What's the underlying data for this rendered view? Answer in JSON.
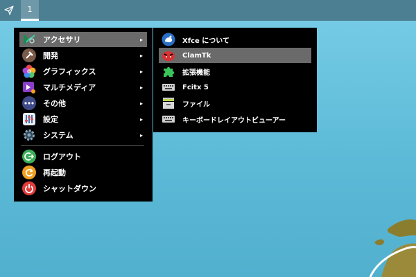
{
  "panel": {
    "workspace_label": "1"
  },
  "menu": {
    "items": [
      {
        "label": "アクセサリ",
        "icon": "accessories-icon",
        "has_submenu": true
      },
      {
        "label": "開発",
        "icon": "development-icon",
        "has_submenu": true
      },
      {
        "label": "グラフィックス",
        "icon": "graphics-icon",
        "has_submenu": true
      },
      {
        "label": "マルチメディア",
        "icon": "multimedia-icon",
        "has_submenu": true
      },
      {
        "label": "その他",
        "icon": "other-icon",
        "has_submenu": true
      },
      {
        "label": "設定",
        "icon": "settings-icon",
        "has_submenu": true
      },
      {
        "label": "システム",
        "icon": "system-icon",
        "has_submenu": true
      }
    ],
    "actions": [
      {
        "label": "ログアウト",
        "icon": "logout-icon"
      },
      {
        "label": "再起動",
        "icon": "restart-icon"
      },
      {
        "label": "シャットダウン",
        "icon": "shutdown-icon"
      }
    ],
    "submenu_arrow": "▸"
  },
  "submenu": {
    "items": [
      {
        "label": "Xfce について",
        "icon": "xfce-mouse-icon"
      },
      {
        "label": "ClamTk",
        "icon": "clamtk-icon"
      },
      {
        "label": "拡張機能",
        "icon": "puzzle-icon"
      },
      {
        "label": "Fcitx 5",
        "icon": "keyboard-icon"
      },
      {
        "label": "ファイル",
        "icon": "file-cabinet-icon"
      },
      {
        "label": "キーボードレイアウトビューアー",
        "icon": "keyboard-layout-icon"
      }
    ]
  },
  "colors": {
    "panel": "#4d7f93",
    "menu_bg": "#000000",
    "highlight": "#6a6a6a",
    "desktop": "#5dbbd8"
  }
}
